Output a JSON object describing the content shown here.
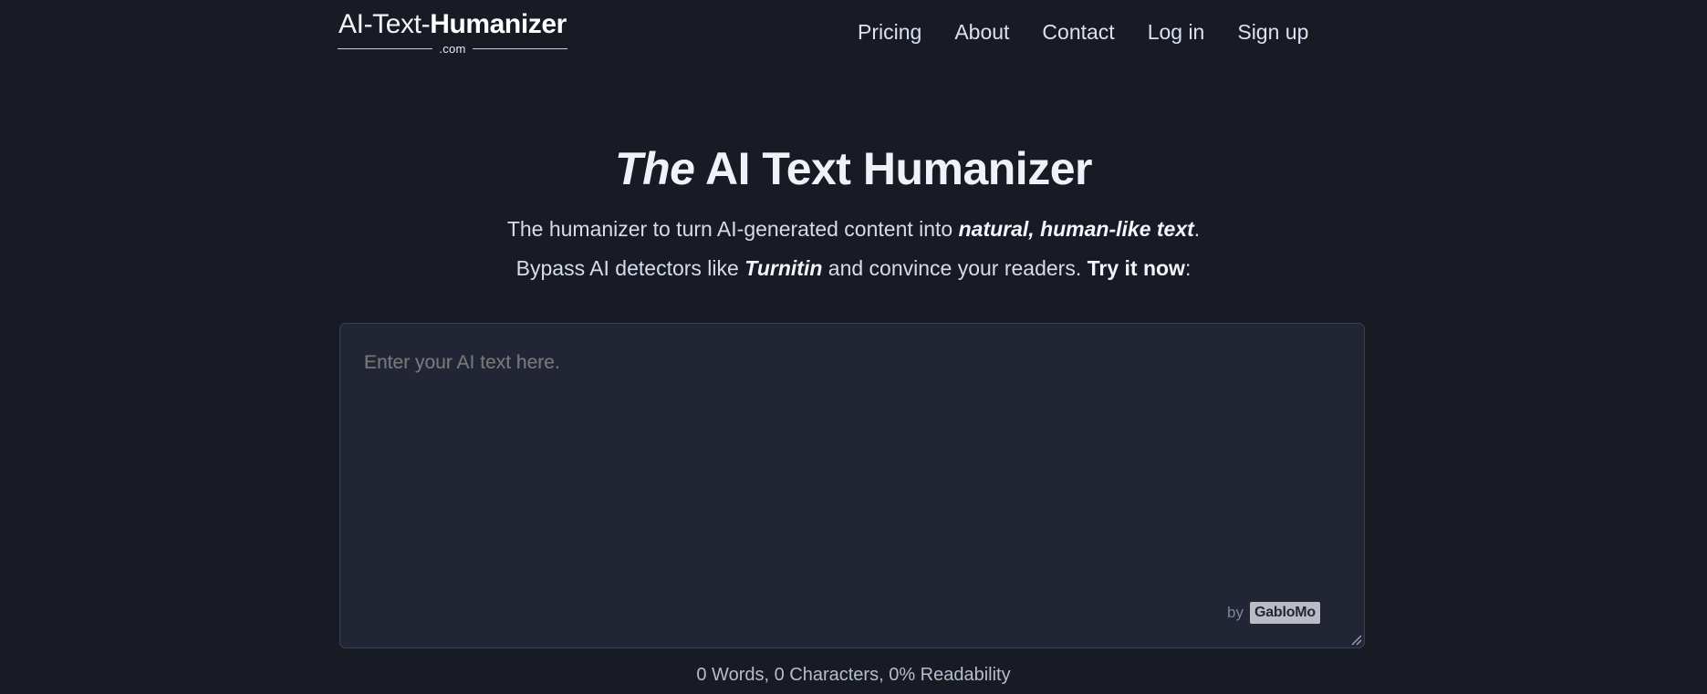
{
  "brand": {
    "name_light": "AI-Text-",
    "name_bold": "Humanizer",
    "domain_suffix": ".com"
  },
  "nav": {
    "items": [
      {
        "label": "Pricing"
      },
      {
        "label": "About"
      },
      {
        "label": "Contact"
      },
      {
        "label": "Log in"
      },
      {
        "label": "Sign up"
      }
    ]
  },
  "hero": {
    "title_emphasis": "The",
    "title_rest": " AI Text Humanizer",
    "subtitle_line1_pre": "The humanizer to turn AI-generated content into ",
    "subtitle_line1_strong": "natural, human-like text",
    "subtitle_line1_post": ".",
    "subtitle_line2_pre": "Bypass AI detectors like ",
    "subtitle_line2_brand": "Turnitin",
    "subtitle_line2_mid": " and convince your readers. ",
    "subtitle_line2_cta": "Try it now",
    "subtitle_line2_post": ":"
  },
  "editor": {
    "placeholder": "Enter your AI text here.",
    "value": "",
    "credit_prefix": "by",
    "credit_badge": "GabloMo",
    "resize_handle_icon": "resize-grip-icon"
  },
  "stats": {
    "text": "0 Words, 0 Characters, 0% Readability",
    "words": 0,
    "characters": 0,
    "readability_percent": 0
  },
  "colors": {
    "page_background": "#181b24",
    "editor_background": "#212534",
    "editor_border": "#39405a",
    "text_primary": "#eff2f8",
    "text_secondary": "#d6dcec",
    "text_muted": "#8e96ad",
    "badge_background": "#b9bcc4"
  }
}
